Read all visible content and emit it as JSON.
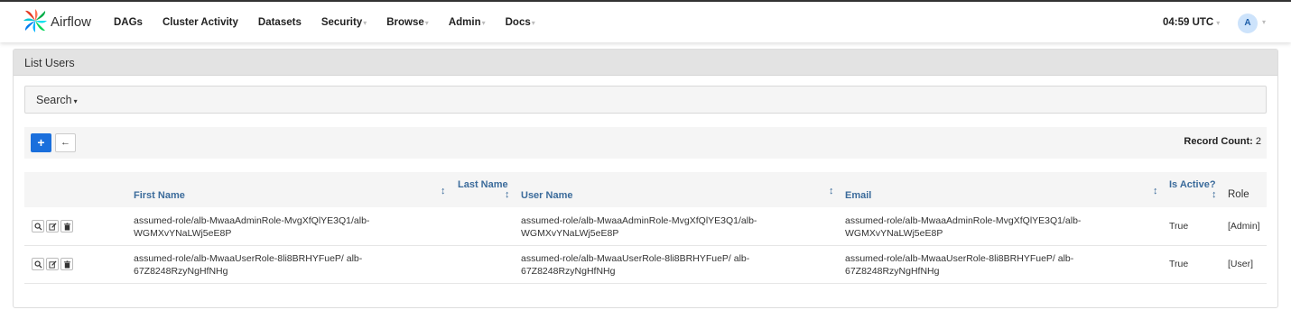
{
  "navbar": {
    "brand": "Airflow",
    "items": [
      {
        "label": "DAGs",
        "dropdown": false
      },
      {
        "label": "Cluster Activity",
        "dropdown": false
      },
      {
        "label": "Datasets",
        "dropdown": false
      },
      {
        "label": "Security",
        "dropdown": true
      },
      {
        "label": "Browse",
        "dropdown": true
      },
      {
        "label": "Admin",
        "dropdown": true
      },
      {
        "label": "Docs",
        "dropdown": true
      }
    ],
    "time": "04:59 UTC",
    "user_initial": "A"
  },
  "panel": {
    "title": "List Users",
    "search_label": "Search",
    "add_button": "+",
    "back_button": "←",
    "record_count_label": "Record Count:",
    "record_count": "2"
  },
  "table": {
    "columns": [
      "First Name",
      "Last Name",
      "User Name",
      "Email",
      "Is Active?",
      "Role"
    ],
    "rows": [
      {
        "first_name": "assumed-role/alb-MwaaAdminRole-MvgXfQlYE3Q1/alb-WGMXvYNaLWj5eE8P",
        "last_name": "",
        "user_name": "assumed-role/alb-MwaaAdminRole-MvgXfQlYE3Q1/alb-WGMXvYNaLWj5eE8P",
        "email": "assumed-role/alb-MwaaAdminRole-MvgXfQlYE3Q1/alb-WGMXvYNaLWj5eE8P",
        "is_active": "True",
        "role": "[Admin]"
      },
      {
        "first_name": "assumed-role/alb-MwaaUserRole-8li8BRHYFueP/ alb-67Z8248RzyNgHfNHg",
        "last_name": "",
        "user_name": "assumed-role/alb-MwaaUserRole-8li8BRHYFueP/ alb-67Z8248RzyNgHfNHg",
        "email": "assumed-role/alb-MwaaUserRole-8li8BRHYFueP/ alb-67Z8248RzyNgHfNHg",
        "is_active": "True",
        "role": "[User]"
      }
    ]
  },
  "colors": {
    "primary": "#1a6fdc",
    "header_link": "#3b6b9b",
    "panel_head": "#e3e3e3"
  }
}
